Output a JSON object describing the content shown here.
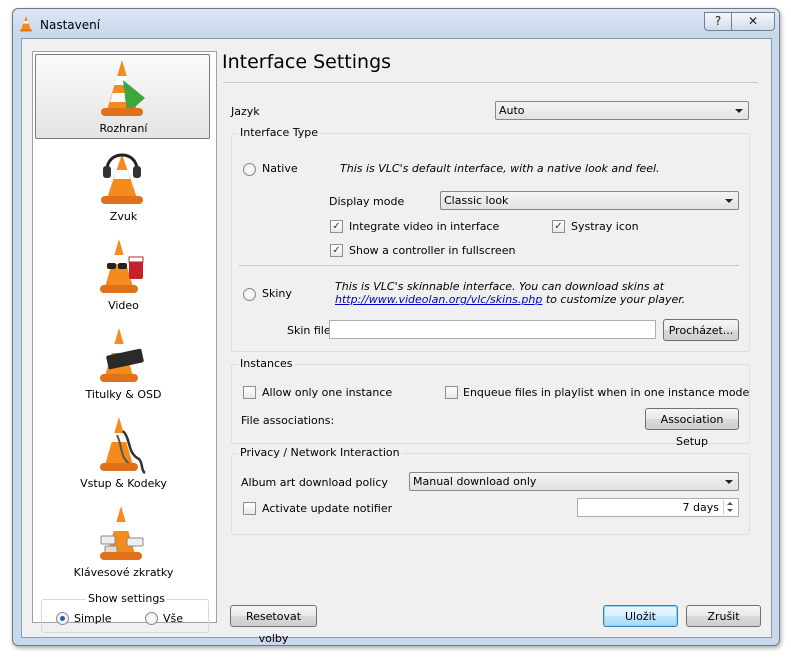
{
  "window": {
    "title": "Nastavení",
    "help_label": "?",
    "close_label": "✕"
  },
  "sidebar": {
    "items": [
      {
        "label": "Rozhraní"
      },
      {
        "label": "Zvuk"
      },
      {
        "label": "Video"
      },
      {
        "label": "Titulky & OSD"
      },
      {
        "label": "Vstup & Kodeky"
      },
      {
        "label": "Klávesové zkratky"
      }
    ],
    "show_settings": {
      "title": "Show settings",
      "simple_label": "Simple",
      "all_label": "Vše",
      "selected": "Simple"
    }
  },
  "main": {
    "title": "Interface Settings",
    "language": {
      "label": "Jazyk",
      "value": "Auto"
    },
    "interface_type": {
      "title": "Interface Type",
      "native": {
        "label": "Native",
        "description": "This is VLC's default interface, with a native look and feel."
      },
      "display_mode": {
        "label": "Display mode",
        "value": "Classic look"
      },
      "integrate_video": {
        "label": "Integrate video in interface",
        "checked": true
      },
      "systray_icon": {
        "label": "Systray icon",
        "checked": true
      },
      "fullscreen_controller": {
        "label": "Show a controller in fullscreen",
        "checked": true
      },
      "skins": {
        "label": "Skiny",
        "description_line1": "This is VLC's skinnable interface. You can download skins at",
        "link": "http://www.videolan.org/vlc/skins.php",
        "description_line2": " to customize your player."
      },
      "skin_file": {
        "label": "Skin file",
        "value": "",
        "browse_label": "Procházet..."
      }
    },
    "instances": {
      "title": "Instances",
      "one_instance": {
        "label": "Allow only one instance",
        "checked": false
      },
      "enqueue": {
        "label": "Enqueue files in playlist when in one instance mode",
        "checked": false
      },
      "file_assoc_label": "File associations:",
      "assoc_button": "Association Setup"
    },
    "privacy": {
      "title": "Privacy / Network Interaction",
      "album_art": {
        "label": "Album art download policy",
        "value": "Manual download only"
      },
      "update_notifier": {
        "label": "Activate update notifier",
        "checked": false,
        "interval": "7 days"
      }
    }
  },
  "buttons": {
    "reset": "Resetovat volby",
    "save": "Uložit",
    "cancel": "Zrušit"
  }
}
